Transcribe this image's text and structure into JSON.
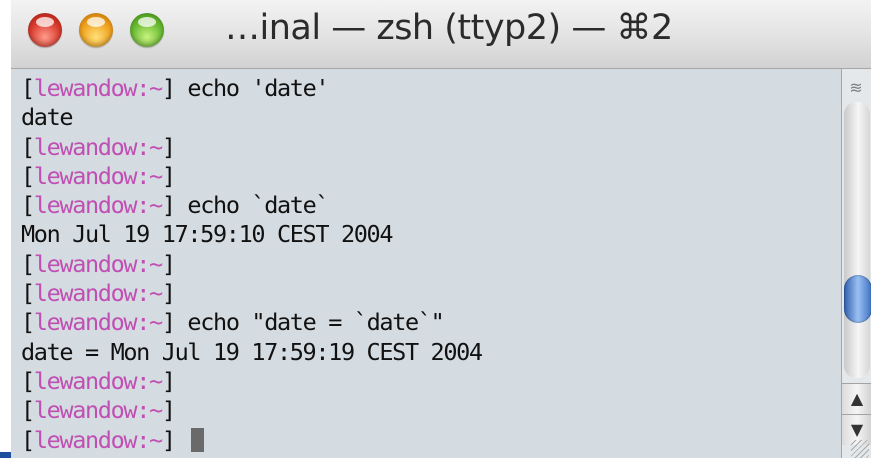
{
  "window": {
    "title": "…inal — zsh (ttyp2) — ⌘2",
    "buttons": [
      "close-button",
      "minimize-button",
      "zoom-button"
    ]
  },
  "terminal": {
    "prompt_user": "lewandow",
    "lines": [
      {
        "open": "[",
        "user": "lewandow",
        "close": ":~]",
        "text": " echo 'date'"
      },
      {
        "output": "date"
      },
      {
        "open": "[",
        "user": "lewandow",
        "close": ":~]",
        "text": ""
      },
      {
        "open": "[",
        "user": "lewandow",
        "close": ":~]",
        "text": ""
      },
      {
        "open": "[",
        "user": "lewandow",
        "close": ":~]",
        "text": " echo `date`"
      },
      {
        "output": "Mon Jul 19 17:59:10 CEST 2004"
      },
      {
        "open": "[",
        "user": "lewandow",
        "close": ":~]",
        "text": ""
      },
      {
        "open": "[",
        "user": "lewandow",
        "close": ":~]",
        "text": ""
      },
      {
        "open": "[",
        "user": "lewandow",
        "close": ":~]",
        "text": " echo \"date = `date`\""
      },
      {
        "output": "date = Mon Jul 19 17:59:19 CEST 2004"
      },
      {
        "open": "[",
        "user": "lewandow",
        "close": ":~]",
        "text": ""
      },
      {
        "open": "[",
        "user": "lewandow",
        "close": ":~]",
        "text": ""
      },
      {
        "open": "[",
        "user": "lewandow",
        "close": ":~]",
        "text": " ",
        "cursor": true
      }
    ]
  },
  "scrollbar": {
    "position_fraction": 0.76,
    "up_arrow": "▲",
    "down_arrow": "▼",
    "grip_icon": "≋"
  },
  "colors": {
    "prompt_user": "#c04fb3",
    "terminal_bg": "#d5dce1",
    "text": "#111111"
  }
}
